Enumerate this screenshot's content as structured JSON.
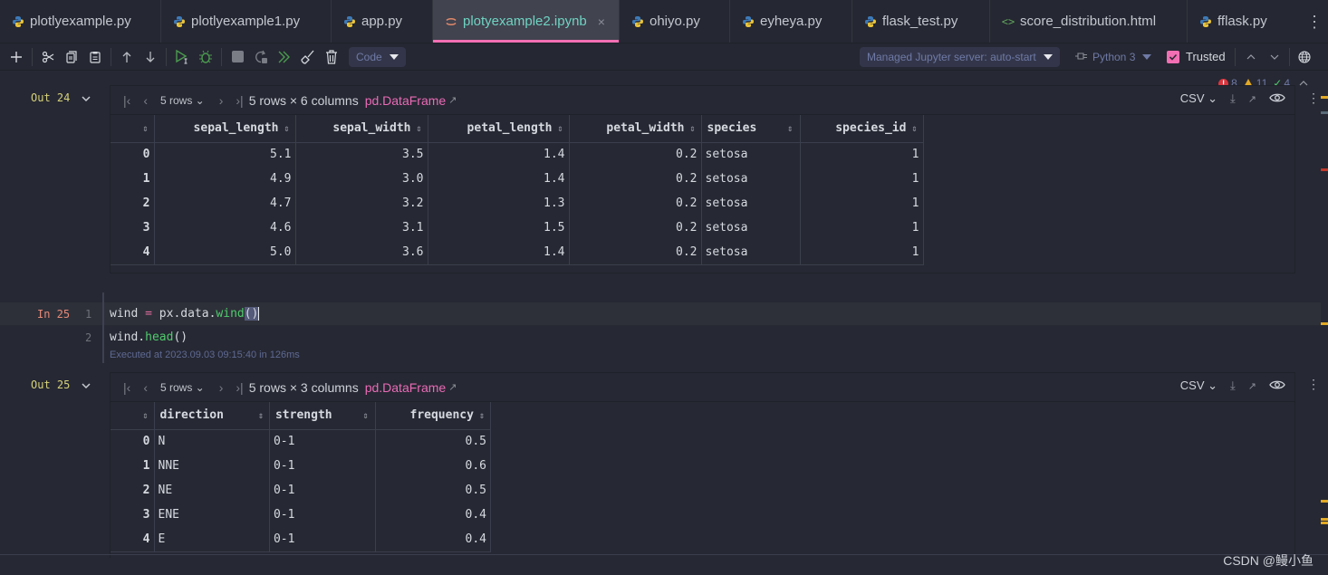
{
  "tabs": [
    {
      "label": "plotlyexample.py",
      "icon": "python-icon",
      "active": false
    },
    {
      "label": "plotlyexample1.py",
      "icon": "python-icon",
      "active": false
    },
    {
      "label": "app.py",
      "icon": "python-icon",
      "active": false
    },
    {
      "label": "plotyexample2.ipynb",
      "icon": "notebook-icon",
      "active": true
    },
    {
      "label": "ohiyo.py",
      "icon": "python-icon",
      "active": false
    },
    {
      "label": "eyheya.py",
      "icon": "python-icon",
      "active": false
    },
    {
      "label": "flask_test.py",
      "icon": "python-icon",
      "active": false
    },
    {
      "label": "score_distribution.html",
      "icon": "html-icon",
      "active": false
    },
    {
      "label": "fflask.py",
      "icon": "python-icon",
      "active": false
    }
  ],
  "tab_close": "×",
  "toolbar": {
    "cell_type": "Code",
    "server": "Managed Jupyter server: auto-start",
    "kernel": "Python 3",
    "trusted_label": "Trusted",
    "trusted_checked": true
  },
  "status": {
    "errors": "8",
    "warnings": "11",
    "ok": "4"
  },
  "colors": {
    "accent_pink": "#f26fb3",
    "active_tab_text": "#6fd3c2",
    "error": "#d9363e",
    "warning": "#e2a925",
    "ok": "#4fcb6c"
  },
  "out24": {
    "label": "Out 24",
    "rows_select": "5 rows",
    "summary": "5 rows × 6 columns",
    "type": "pd.DataFrame",
    "format": "CSV",
    "columns": [
      "",
      "sepal_length",
      "sepal_width",
      "petal_length",
      "petal_width",
      "species",
      "species_id"
    ],
    "rows": [
      [
        "0",
        "5.1",
        "3.5",
        "1.4",
        "0.2",
        "setosa",
        "1"
      ],
      [
        "1",
        "4.9",
        "3.0",
        "1.4",
        "0.2",
        "setosa",
        "1"
      ],
      [
        "2",
        "4.7",
        "3.2",
        "1.3",
        "0.2",
        "setosa",
        "1"
      ],
      [
        "3",
        "4.6",
        "3.1",
        "1.5",
        "0.2",
        "setosa",
        "1"
      ],
      [
        "4",
        "5.0",
        "3.6",
        "1.4",
        "0.2",
        "setosa",
        "1"
      ]
    ]
  },
  "in25": {
    "label": "In 25",
    "lines": [
      {
        "num": "1",
        "var": "wind",
        "op": " = ",
        "obj": "px.data.",
        "fn": "wind",
        "args": "()"
      },
      {
        "num": "2",
        "var": "wind.",
        "fn": "head",
        "args": "()"
      }
    ],
    "executed": "Executed at 2023.09.03 09:15:40 in 126ms"
  },
  "out25": {
    "label": "Out 25",
    "rows_select": "5 rows",
    "summary": "5 rows × 3 columns",
    "type": "pd.DataFrame",
    "format": "CSV",
    "columns": [
      "",
      "direction",
      "strength",
      "frequency"
    ],
    "rows": [
      [
        "0",
        "N",
        "0-1",
        "0.5"
      ],
      [
        "1",
        "NNE",
        "0-1",
        "0.6"
      ],
      [
        "2",
        "NE",
        "0-1",
        "0.5"
      ],
      [
        "3",
        "ENE",
        "0-1",
        "0.4"
      ],
      [
        "4",
        "E",
        "0-1",
        "0.4"
      ]
    ]
  },
  "watermark": "CSDN @鳗小鱼"
}
